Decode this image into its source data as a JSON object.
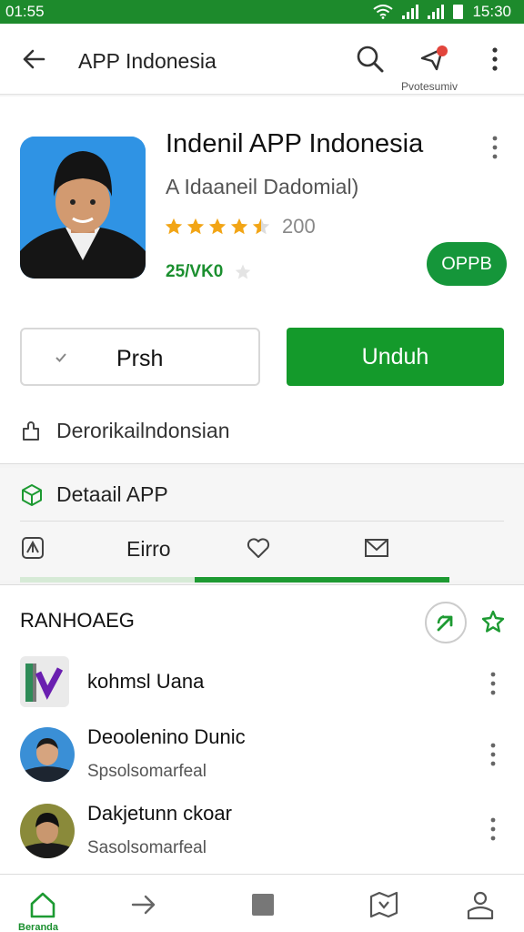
{
  "status_bar": {
    "time_left": "01:55",
    "time_right": "15:30"
  },
  "app_bar": {
    "title": "APP Indonesia",
    "subtitle_under": "Pvotesumiv"
  },
  "app": {
    "name": "Indenil APP Indonesia",
    "developer": "A Idaaneil Dadomial)",
    "rating_stars": 4.5,
    "rating_count": "200",
    "size": "25/VK0",
    "badge": "OPPB",
    "secondary_button": "Prsh",
    "primary_button": "Unduh",
    "developer_link": "Derorikailndonsian"
  },
  "details": {
    "heading": "Detaail APP",
    "tab_label": "Eirro",
    "progress_range": [
      0.41,
      1.0
    ]
  },
  "related": {
    "title": "RANHOAEG",
    "items": [
      {
        "name": "kohmsl Uana",
        "sub": ""
      },
      {
        "name": "Deoolenino Dunic",
        "sub": "Spsolsomarfeal"
      },
      {
        "name": "Dakjetunn ckoar",
        "sub": "Sasolsomarfeal"
      }
    ]
  },
  "bottom_nav": {
    "first_label": "Beranda"
  },
  "colors": {
    "green": "#1d9a32",
    "status_bar": "#1d8a2c",
    "star": "#f2a516"
  }
}
